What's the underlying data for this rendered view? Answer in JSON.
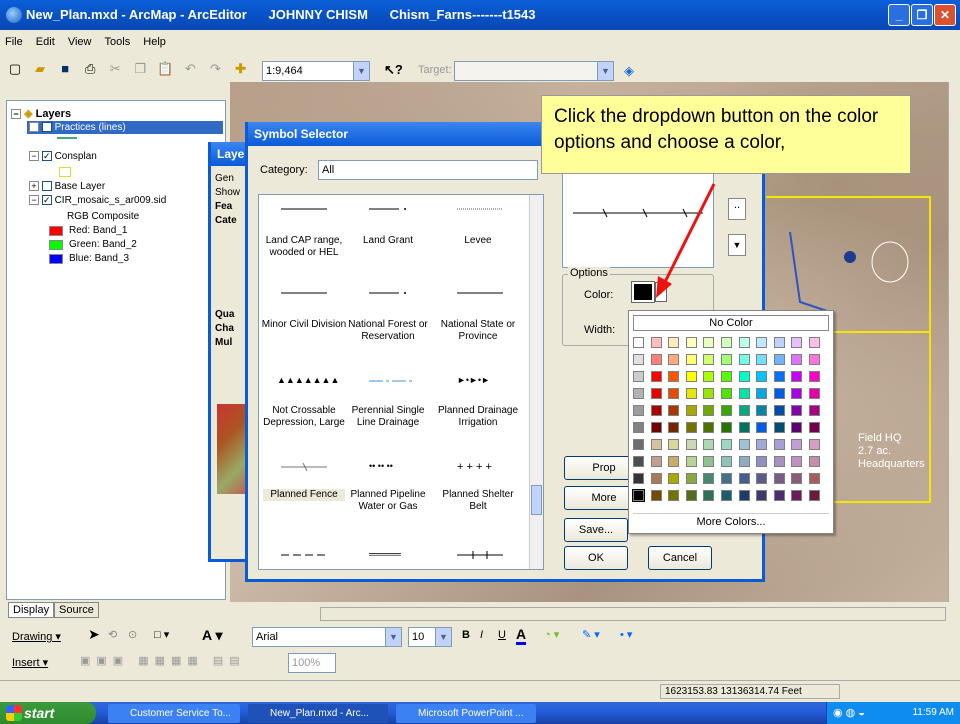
{
  "window": {
    "title": "New_Plan.mxd - ArcMap - ArcEditor      JOHNNY CHISM      Chism_Farns-------t1543",
    "min": "_",
    "max": "❐",
    "close": "✕"
  },
  "menu": [
    "File",
    "Edit",
    "View",
    "Tools",
    "Help"
  ],
  "toolbar": {
    "scale": "1:9,464",
    "target_label": "Target:"
  },
  "toc": {
    "root": "Layers",
    "items": [
      "Practices (lines)",
      "Consplan",
      "Base Layer",
      "CIR_mosaic_s_ar009.sid",
      "RGB Composite",
      "Red:   Band_1",
      "Green: Band_2",
      "Blue:  Band_3"
    ],
    "band_colors": [
      "#ff0000",
      "#00ff00",
      "#0000ff"
    ],
    "tabs": [
      "Display",
      "Source"
    ]
  },
  "layer_props": {
    "title": "Layer",
    "frags": [
      "Gen",
      "Show",
      "Fea",
      "Cate",
      "Qua",
      "Cha",
      "Mul"
    ]
  },
  "symbol_selector": {
    "title": "Symbol Selector",
    "category_label": "Category:",
    "category_value": "All",
    "symbols": [
      "Land CAP range, wooded or HEL",
      "Land Grant",
      "Levee",
      "Minor Civil Division",
      "National Forest or Reservation",
      "National State or Province",
      "Not Crossable Depression, Large",
      "Perennial Single Line Drainage",
      "Planned Drainage Irrigation",
      "Planned Fence",
      "Planned Pipeline Water or Gas",
      "Planned Shelter Belt"
    ],
    "glyphs": [
      "▲▲▲▲▲▲▲",
      "►•►•►",
      "+ + + +",
      "•• •• ••",
      "═════"
    ],
    "options_label": "Options",
    "color_label": "Color:",
    "width_label": "Width:",
    "buttons": {
      "props": "Prop",
      "more": "More",
      "save": "Save...",
      "ok": "OK",
      "cancel": "Cancel"
    }
  },
  "callout": "Click the dropdown button on the color options and choose a color,",
  "palette": {
    "no_color": "No Color",
    "more_colors": "More Colors...",
    "rows": [
      [
        "#ffffff",
        "#ffbebe",
        "#ffebbe",
        "#ffffbe",
        "#e9ffbe",
        "#d3ffbe",
        "#beffe8",
        "#bee8ff",
        "#bed2ff",
        "#e8beff",
        "#ffbee8"
      ],
      [
        "#e1e1e1",
        "#ff7f7f",
        "#ffa77f",
        "#ffff73",
        "#d1ff73",
        "#a3ff73",
        "#73ffdf",
        "#73dfff",
        "#73b2ff",
        "#df73ff",
        "#ff73df"
      ],
      [
        "#cccccc",
        "#ff0000",
        "#ff5500",
        "#ffff00",
        "#aaff00",
        "#55ff00",
        "#00ffc5",
        "#00c5ff",
        "#0070ff",
        "#c500ff",
        "#ff00c5"
      ],
      [
        "#b2b2b2",
        "#e60000",
        "#e64c00",
        "#e6e600",
        "#98e600",
        "#4ce600",
        "#00e6a9",
        "#00a9e6",
        "#005ce6",
        "#a900e6",
        "#e600a9"
      ],
      [
        "#9c9c9c",
        "#a80000",
        "#a83800",
        "#a8a800",
        "#70a800",
        "#38a800",
        "#00a884",
        "#0084a8",
        "#004da8",
        "#8400a8",
        "#a80084"
      ],
      [
        "#828282",
        "#730000",
        "#732600",
        "#737300",
        "#4c7300",
        "#267300",
        "#00735c",
        "#005ce6",
        "#004c73",
        "#5c0073",
        "#73004c"
      ],
      [
        "#6e6e6e",
        "#d7c29e",
        "#d7d79e",
        "#cdd7b4",
        "#aed7b4",
        "#9ed7c2",
        "#9ec2d7",
        "#9eaad7",
        "#aa9ed7",
        "#c29ed7",
        "#d79ec2"
      ],
      [
        "#4e4e4e",
        "#c29e8f",
        "#cdaa66",
        "#bad28f",
        "#8fc28f",
        "#8fc2bd",
        "#8faac2",
        "#8f8fc2",
        "#aa8fc2",
        "#c28fc2",
        "#c28faa"
      ],
      [
        "#343434",
        "#a87a5c",
        "#a8a800",
        "#89a844",
        "#448970",
        "#447089",
        "#445f89",
        "#5c5c89",
        "#7a5c89",
        "#895c7a",
        "#a85c5c"
      ],
      [
        "#000000",
        "#734c00",
        "#737300",
        "#576c1b",
        "#2d7054",
        "#1b5d6c",
        "#1b3c6c",
        "#3a3a6c",
        "#4c2d70",
        "#6c1b5d",
        "#6c1b3c"
      ]
    ]
  },
  "drawing": {
    "label": "Drawing",
    "font": "Arial",
    "size": "10",
    "bold": "B",
    "italic": "I",
    "underline": "U",
    "a": "A"
  },
  "insert": {
    "label": "Insert",
    "zoom": "100%"
  },
  "status": {
    "coords": "1623153.83  13136314.74 Feet"
  },
  "map_labels": {
    "field": "Field  HQ",
    "acres": "2.7 ac.",
    "hq": "Headquarters"
  },
  "taskbar": {
    "start": "start",
    "tasks": [
      "Customer Service To...",
      "New_Plan.mxd - Arc...",
      "Microsoft PowerPoint ..."
    ],
    "clock": "11:59 AM"
  }
}
